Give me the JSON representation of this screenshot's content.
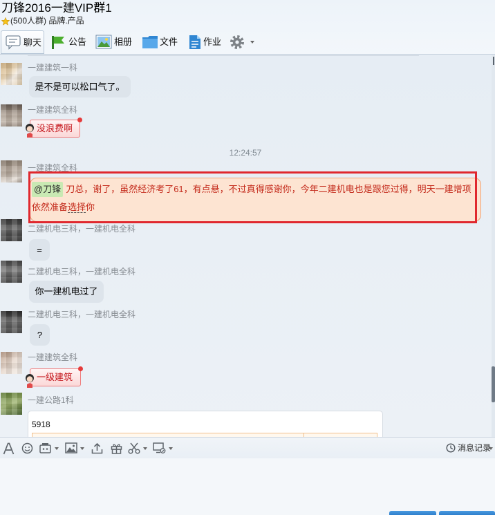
{
  "window": {
    "title": "刀锋2016一建VIP群1",
    "group_info": "(500人群) 品牌.产品",
    "group_icon": "star-icon"
  },
  "tabs": [
    {
      "label": "聊天",
      "icon": "chat-icon",
      "active": true
    },
    {
      "label": "公告",
      "icon": "megaphone-icon",
      "active": false
    },
    {
      "label": "相册",
      "icon": "photo-album-icon",
      "active": false
    },
    {
      "label": "文件",
      "icon": "folder-icon",
      "active": false
    },
    {
      "label": "作业",
      "icon": "homework-icon",
      "active": false
    }
  ],
  "settings_menu_icon": "gear-icon",
  "chat": {
    "messages": [
      {
        "sender": "一建建筑一科",
        "text": "是不是可以松口气了。"
      },
      {
        "sender": "一建建筑全科",
        "text": "没浪费啊",
        "bubble_style": "sticker"
      },
      {
        "sender": "一建建筑全科",
        "mention": "@刀锋",
        "text": "刀总，谢了，虽然经济考了61，有点悬，不过真得感谢你，今年二建机电也是跟您过得，明天一建增项依然准备",
        "underlined_text": "选择",
        "text_end": "你",
        "highlighted": true
      },
      {
        "sender": "二建机电三科，一建机电全科",
        "text": "="
      },
      {
        "sender": "二建机电三科，一建机电全科",
        "text": "你一建机电过了"
      },
      {
        "sender": "二建机电三科，一建机电全科",
        "text": "?"
      },
      {
        "sender": "一建建筑全科",
        "text": "一级建筑",
        "bubble_style": "sticker"
      },
      {
        "sender": "一建公路1科",
        "card_text": "5918"
      }
    ],
    "time_divider": "12:24:57"
  },
  "input_toolbar": {
    "tools": [
      "font-icon",
      "emoji-icon",
      "gif-icon",
      "image-icon",
      "upload-icon",
      "gift-icon",
      "scissors-icon",
      "screen-icon"
    ],
    "history_icon": "clock-icon",
    "history_label": "消息记录"
  },
  "colors": {
    "highlight_border": "#e0282e",
    "highlighted_bubble": "#fde4d2",
    "highlighted_text": "#c42b1c",
    "mention_background": "#c9e9b3",
    "bubble": "#dde4eb",
    "button_blue": "#2f80cc"
  }
}
